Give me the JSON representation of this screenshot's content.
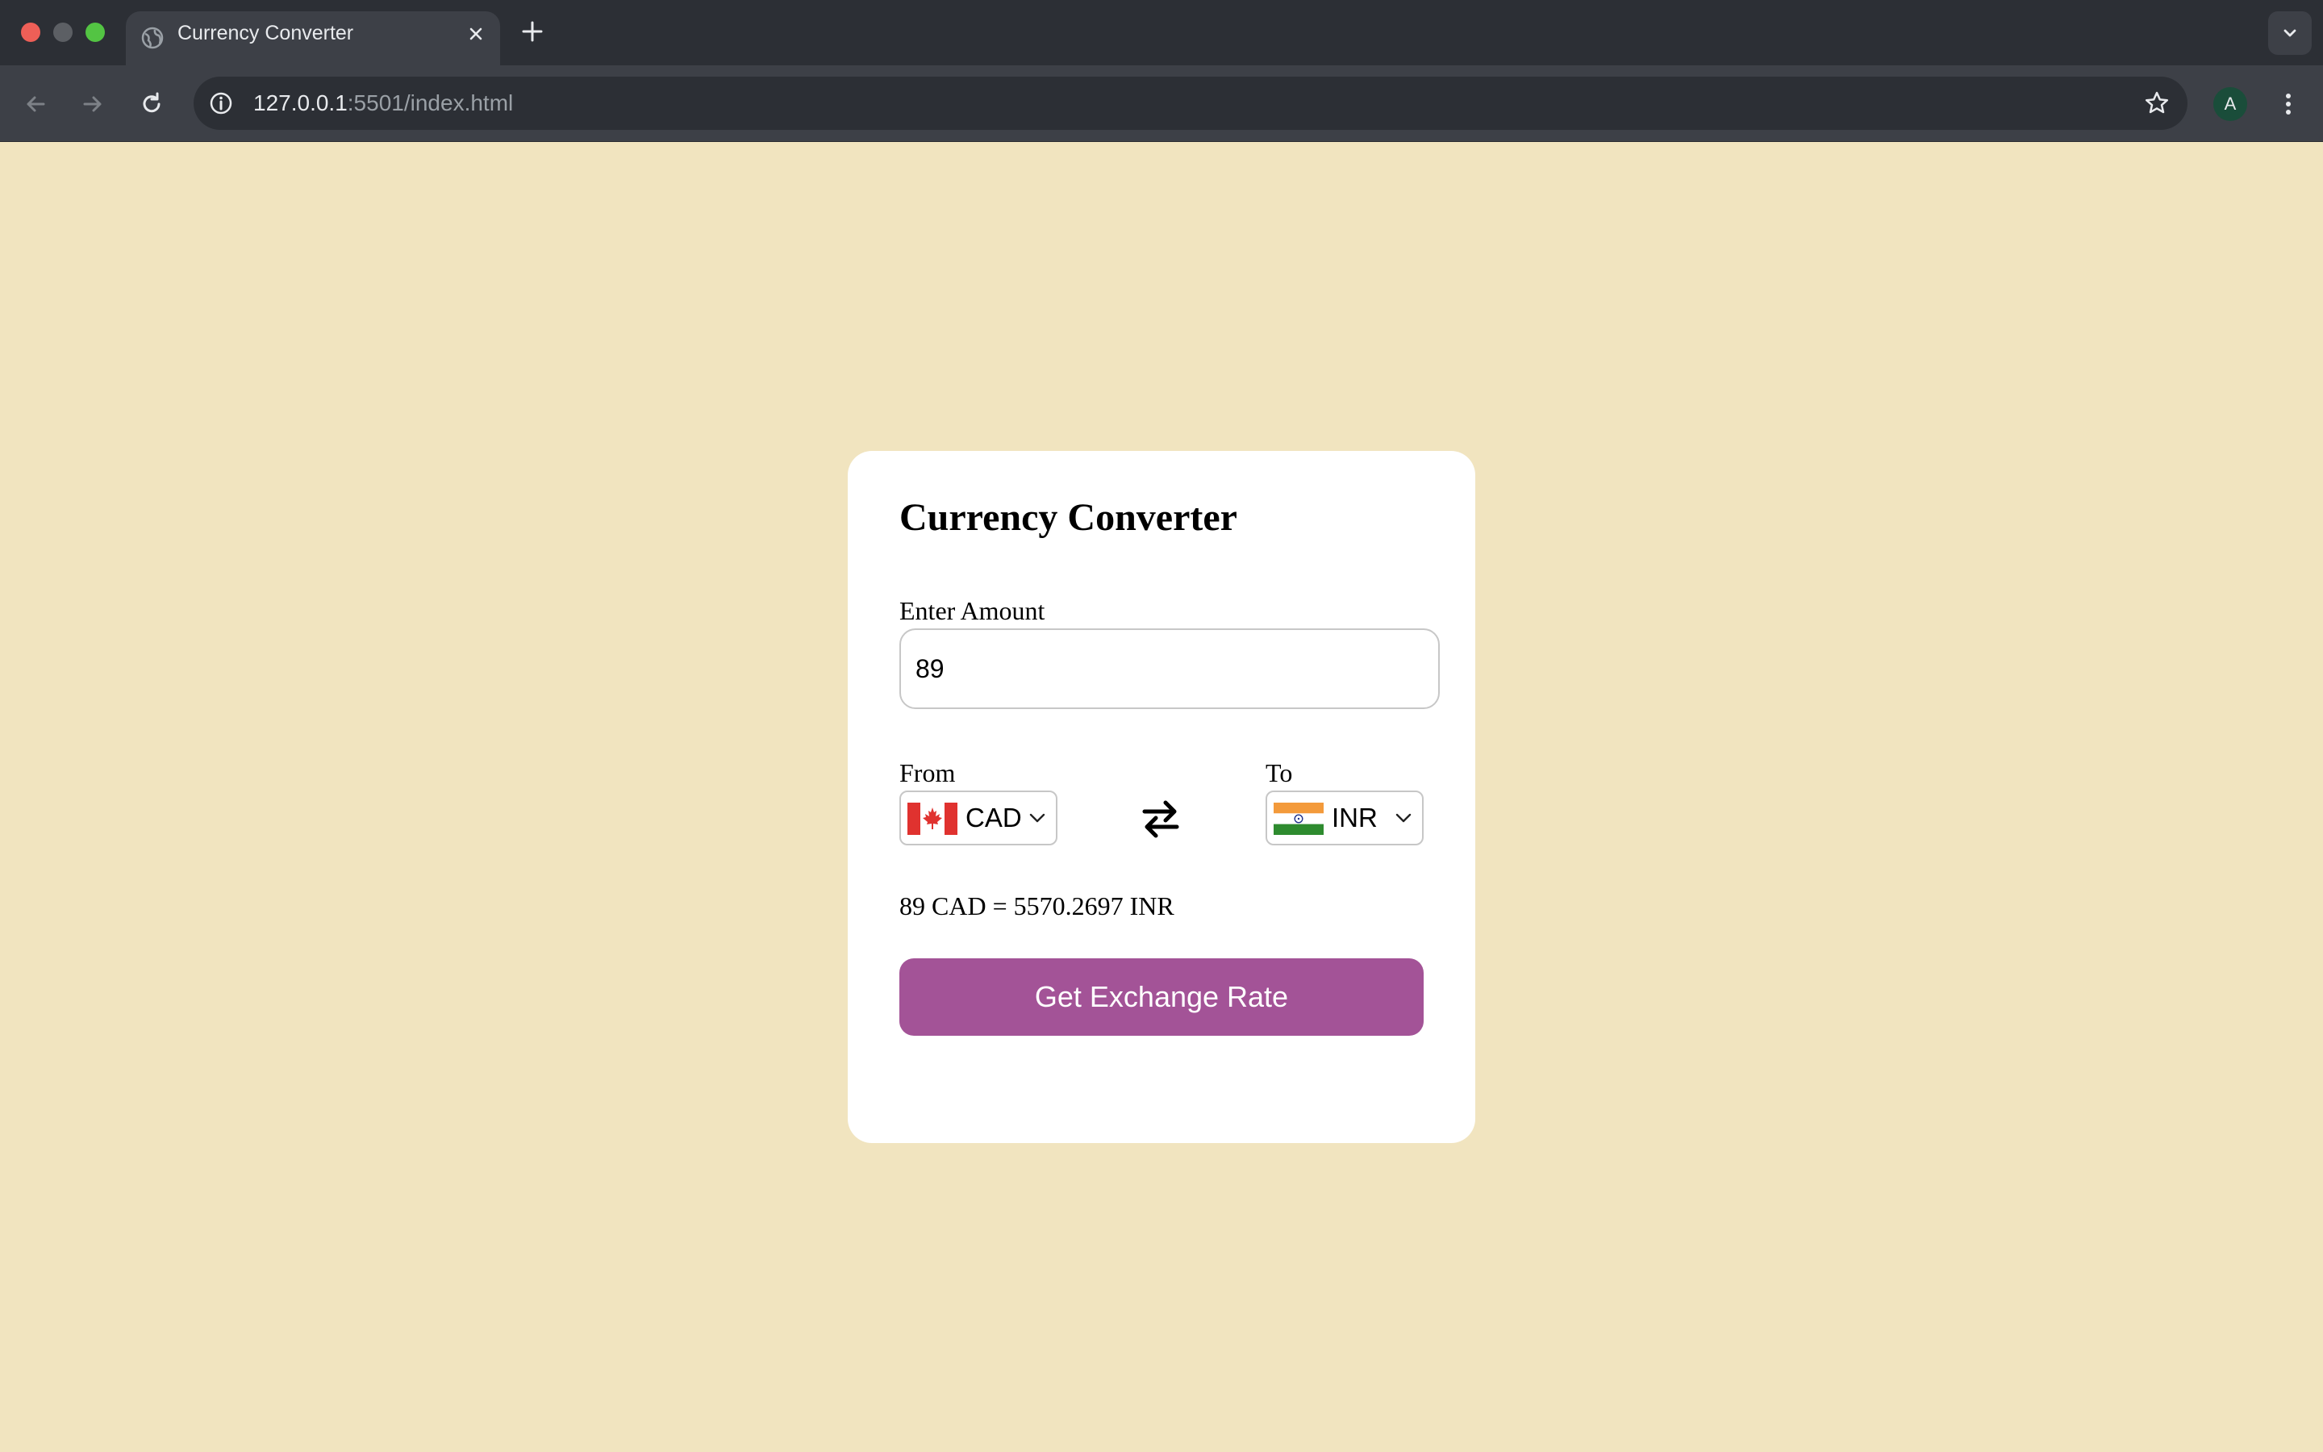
{
  "browser": {
    "tab_title": "Currency Converter",
    "url_host": "127.0.0.1",
    "url_path": ":5501/index.html",
    "profile_initial": "A"
  },
  "converter": {
    "title": "Currency Converter",
    "amount_label": "Enter Amount",
    "amount_value": "89",
    "from_label": "From",
    "from_currency": "CAD",
    "to_label": "To",
    "to_currency": "INR",
    "result_text": "89 CAD = 5570.2697 INR",
    "button_label": "Get Exchange Rate"
  },
  "icons": {
    "from_flag": "canada-flag-icon",
    "to_flag": "india-flag-icon",
    "swap": "swap-arrows-icon"
  },
  "colors": {
    "page_background": "#f1e4bf",
    "card_background": "#ffffff",
    "button_background": "#a35397",
    "button_text": "#ffffff"
  }
}
